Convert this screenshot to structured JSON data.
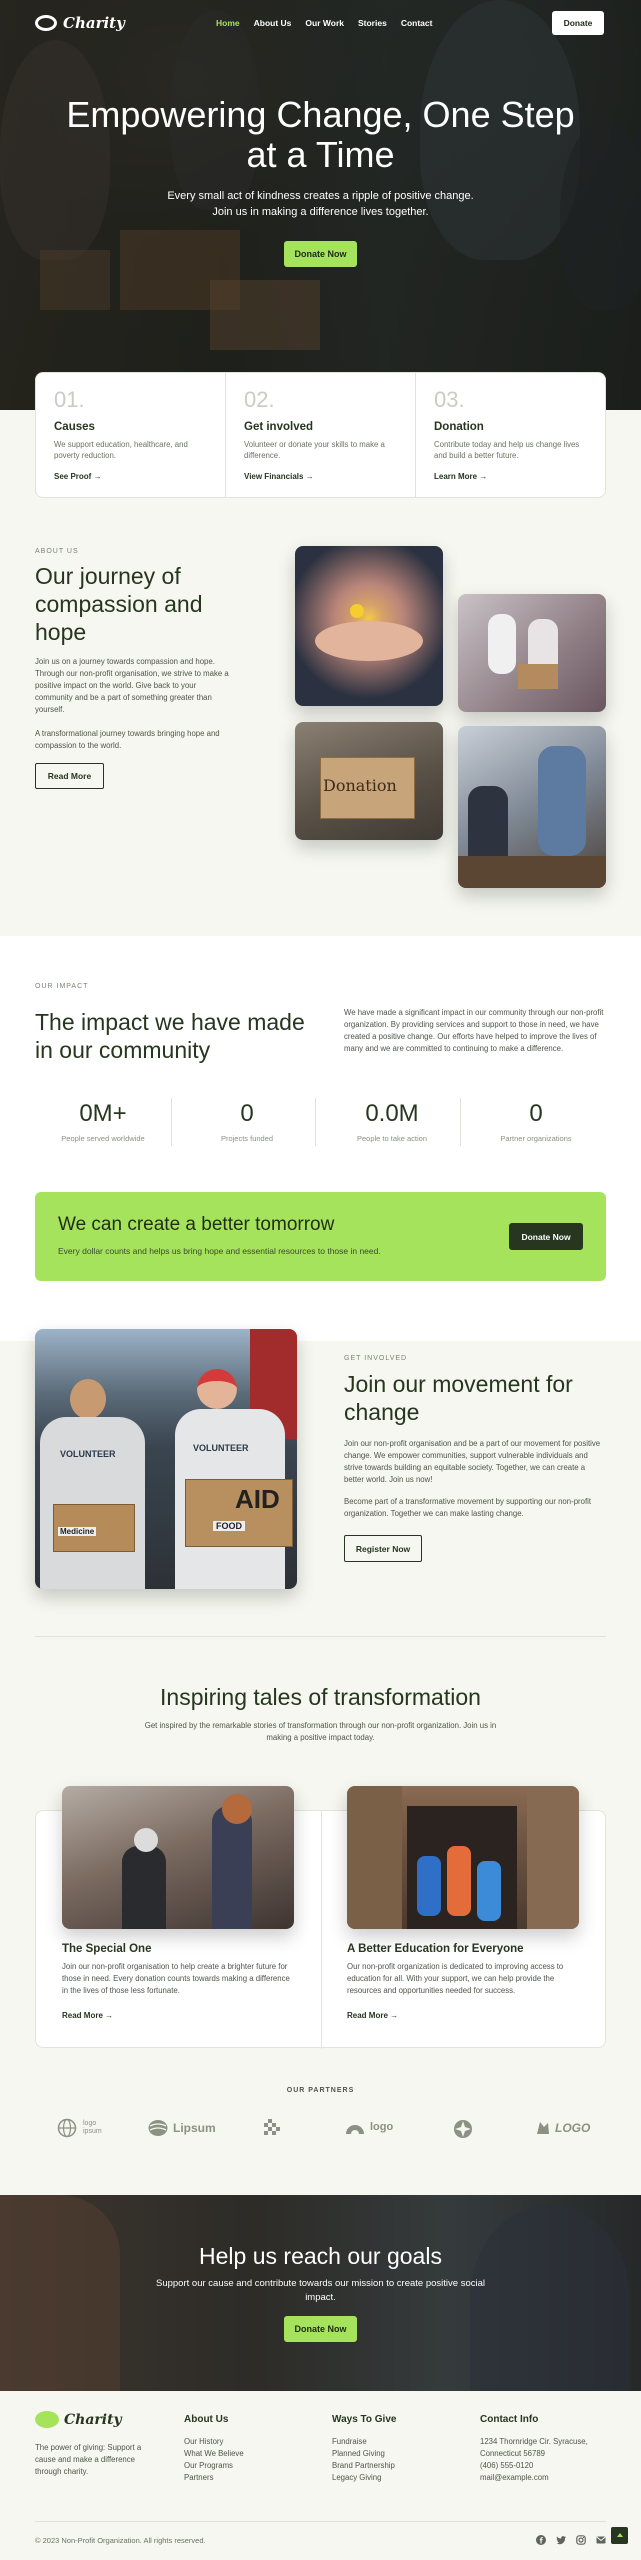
{
  "brand": {
    "name": "Charity",
    "accent": "#a6e35c",
    "dark": "#26361f"
  },
  "nav": {
    "items": [
      "Home",
      "About Us",
      "Our Work",
      "Stories",
      "Contact"
    ],
    "active": "Home",
    "donate_label": "Donate"
  },
  "hero": {
    "title": "Empowering Change, One Step at a Time",
    "subtitle_line1": "Every small act of kindness creates a ripple of positive change.",
    "subtitle_line2": "Join us in making a difference lives together.",
    "button": "Donate Now"
  },
  "features": [
    {
      "num": "01.",
      "title": "Causes",
      "desc": "We support education, healthcare, and poverty reduction.",
      "link": "See Proof →"
    },
    {
      "num": "02.",
      "title": "Get involved",
      "desc": "Volunteer or donate your skills to make a difference.",
      "link": "View Financials →"
    },
    {
      "num": "03.",
      "title": "Donation",
      "desc": "Contribute today and help us change lives and build a better future.",
      "link": "Learn More →"
    }
  ],
  "about": {
    "eyebrow": "ABOUT US",
    "title": "Our journey of compassion and hope",
    "para1": "Join us on a journey towards compassion and hope. Through our non-profit organisation, we strive to make a positive impact on the world. Give back to your community and be a part of something greater than yourself.",
    "para2": "A transformational journey towards bringing hope and compassion to the world.",
    "button": "Read More",
    "photo_alts": [
      "Hands holding a flower",
      "Volunteers packing food",
      "Donation box",
      "Volunteers serving food"
    ],
    "photo_box_label": "Donation"
  },
  "impact": {
    "eyebrow": "OUR IMPACT",
    "title": "The impact we have made in our community",
    "desc": "We have made a significant impact in our community through our non-profit organization. By providing services and support to those in need, we have created a positive change. Our efforts have helped to improve the lives of many and we are committed to continuing to make a difference.",
    "stats": [
      {
        "value": "0M+",
        "label": "People served worldwide"
      },
      {
        "value": "0",
        "label": "Projects funded"
      },
      {
        "value": "0.0M",
        "label": "People to take action"
      },
      {
        "value": "0",
        "label": "Partner organizations"
      }
    ]
  },
  "cta": {
    "title": "We can create a better tomorrow",
    "text": "Every dollar counts and helps us bring hope and essential resources to those in need.",
    "button": "Donate Now"
  },
  "involved": {
    "eyebrow": "GET INVOLVED",
    "title": "Join our movement for change",
    "para1": "Join our non-profit organisation and be a part of our movement for positive change. We empower communities, support vulnerable individuals and strive towards building an equitable society. Together, we can create a better world. Join us now!",
    "para2": "Become part of a transformative movement by supporting our non-profit organization. Together we can make lasting change.",
    "button": "Register Now",
    "shirt_text": "VOLUNTEER",
    "box_labels": [
      "Medicine",
      "AID",
      "FOOD"
    ]
  },
  "stories": {
    "title": "Inspiring tales of transformation",
    "subtitle": "Get inspired by the remarkable stories of transformation through our non-profit organization. Join us in making a positive impact today.",
    "items": [
      {
        "title": "The Special One",
        "desc": "Join our non-profit organisation to help create a brighter future for those in need. Every donation counts towards making a difference in the lives of those less fortunate.",
        "link": "Read More →"
      },
      {
        "title": "A Better Education for Everyone",
        "desc": "Our non-profit organization is dedicated to improving access to education for all. With your support, we can help provide the resources and opportunities needed for success.",
        "link": "Read More →"
      }
    ]
  },
  "partners": {
    "eyebrow": "OUR PARTNERS",
    "logos": [
      "logo-ipsum",
      "Lipsum",
      "checker-logo",
      "logo",
      "circle-logo",
      "LOGO"
    ],
    "labels": [
      "logo ipsum",
      "Lipsum",
      "",
      "logo",
      "",
      "LOGO"
    ]
  },
  "goals": {
    "title": "Help us reach our goals",
    "text": "Support our cause and contribute towards our mission to create positive social impact.",
    "button": "Donate Now"
  },
  "footer": {
    "tagline": "The power of giving: Support a cause and make a difference through charity.",
    "cols": [
      {
        "title": "About Us",
        "items": [
          "Our History",
          "What We Believe",
          "Our Programs",
          "Partners"
        ]
      },
      {
        "title": "Ways To Give",
        "items": [
          "Fundraise",
          "Planned Giving",
          "Brand Partnership",
          "Legacy Giving"
        ]
      },
      {
        "title": "Contact Info",
        "items": [
          "1234 Thornridge Cir. Syracuse,",
          "Connecticut 56789",
          "(406) 555-0120",
          "mail@example.com"
        ]
      }
    ],
    "copyright": "© 2023 Non-Profit Organization. All rights reserved.",
    "social": [
      "facebook-icon",
      "twitter-icon",
      "instagram-icon",
      "mail-icon"
    ]
  }
}
